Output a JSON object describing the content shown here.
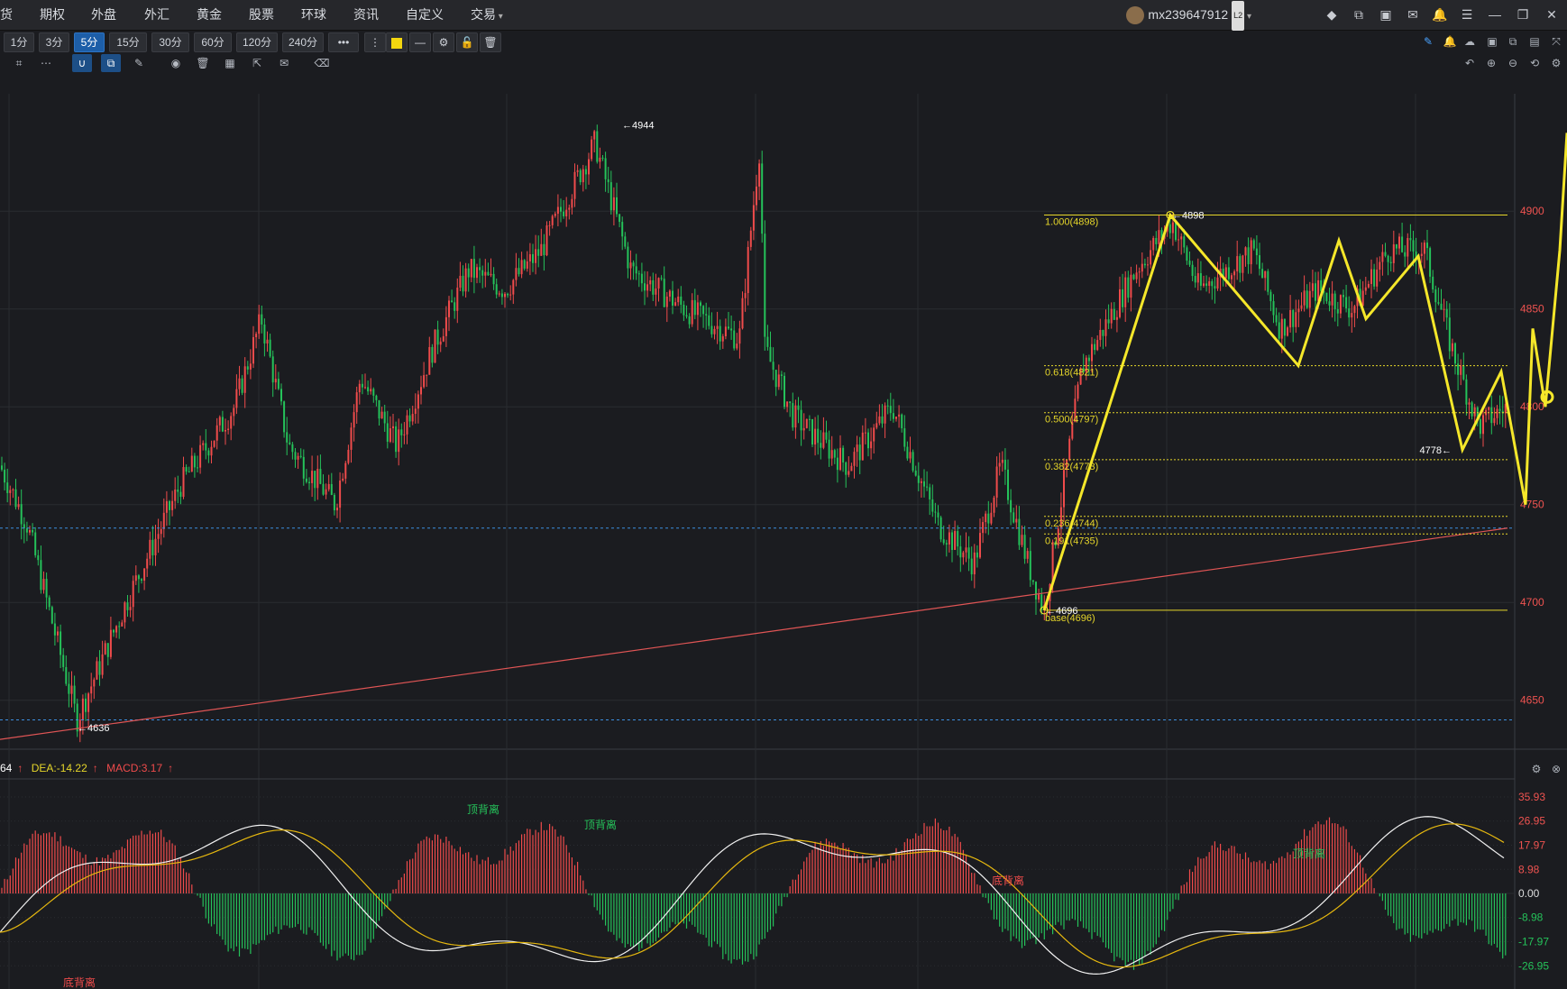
{
  "menu": [
    "货",
    "期权",
    "外盘",
    "外汇",
    "黄金",
    "股票",
    "环球",
    "资讯",
    "自定义",
    "交易"
  ],
  "user": {
    "name": "mx239647912",
    "level": "L2"
  },
  "window_icons": [
    "layers-icon",
    "window-icon",
    "camera-icon",
    "mail-icon",
    "bell-icon",
    "list-icon",
    "minimize-icon",
    "restore-icon",
    "close-icon"
  ],
  "timeframes": [
    "1分",
    "3分",
    "5分",
    "15分",
    "30分",
    "60分",
    "120分",
    "240分"
  ],
  "active_timeframe": "5分",
  "more_label": "•••",
  "colors": {
    "up": "#ef4b4b",
    "down": "#25c25a",
    "fib": "#e6d62a",
    "trend": "#e05555",
    "dash": "#3d8fe0",
    "price_axis": "#ef5350"
  },
  "chart_data": {
    "type": "candlestick",
    "price_axis": {
      "ticks": [
        4900,
        4850,
        4800,
        4750,
        4700,
        4650
      ],
      "range": [
        4625,
        4960
      ]
    },
    "markers": [
      {
        "label": "←4944",
        "price": 4944
      },
      {
        "label": "←4636",
        "price": 4636
      },
      {
        "label": "←4898",
        "price": 4898
      },
      {
        "label": "4778←",
        "price": 4778
      },
      {
        "label": "←4696",
        "price": 4696
      }
    ],
    "fibonacci": [
      {
        "label": "1.000(4898)",
        "price": 4898
      },
      {
        "label": "0.618(4821)",
        "price": 4821
      },
      {
        "label": "0.500(4797)",
        "price": 4797
      },
      {
        "label": "0.382(4773)",
        "price": 4773
      },
      {
        "label": "0.236(4744)",
        "price": 4744
      },
      {
        "label": "0.191(4735)",
        "price": 4735
      },
      {
        "label": "base(4696)",
        "price": 4696
      }
    ],
    "horizontal_dashed": [
      4738,
      4640
    ],
    "macd": {
      "legend": {
        "diff": "64",
        "dea": "DEA:-14.22",
        "macd": "MACD:3.17"
      },
      "axis_ticks": [
        "35.93",
        "26.95",
        "17.97",
        "8.98",
        "0.00",
        "-8.98",
        "-17.97",
        "-26.95"
      ],
      "labels": [
        {
          "text": "顶背离",
          "color": "#25c25a"
        },
        {
          "text": "顶背离",
          "color": "#25c25a"
        },
        {
          "text": "底背离",
          "color": "#ef4b4b"
        },
        {
          "text": "顶背离",
          "color": "#25c25a"
        },
        {
          "text": "底背离",
          "color": "#ef4b4b"
        }
      ]
    }
  }
}
